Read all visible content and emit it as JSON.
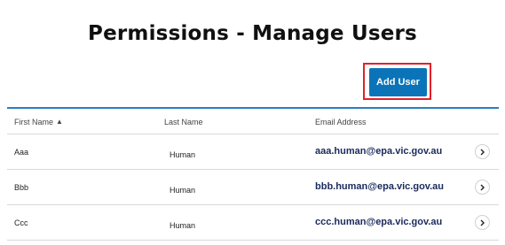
{
  "page": {
    "title": "Permissions - Manage Users"
  },
  "toolbar": {
    "add_user_label": "Add User",
    "highlight_color": "#e3202a",
    "button_color": "#0b74b8"
  },
  "table": {
    "headers": {
      "first_name": "First Name",
      "last_name": "Last Name",
      "email": "Email Address"
    },
    "sort": {
      "column": "first_name",
      "direction": "ascending",
      "icon": "chevron-up-icon"
    },
    "rows": [
      {
        "first_name": "Aaa",
        "last_name": "Human",
        "email": "aaa.human@epa.vic.gov.au"
      },
      {
        "first_name": "Bbb",
        "last_name": "Human",
        "email": "bbb.human@epa.vic.gov.au"
      },
      {
        "first_name": "Ccc",
        "last_name": "Human",
        "email": "ccc.human@epa.vic.gov.au"
      }
    ],
    "row_action_icon": "chevron-right-icon"
  }
}
